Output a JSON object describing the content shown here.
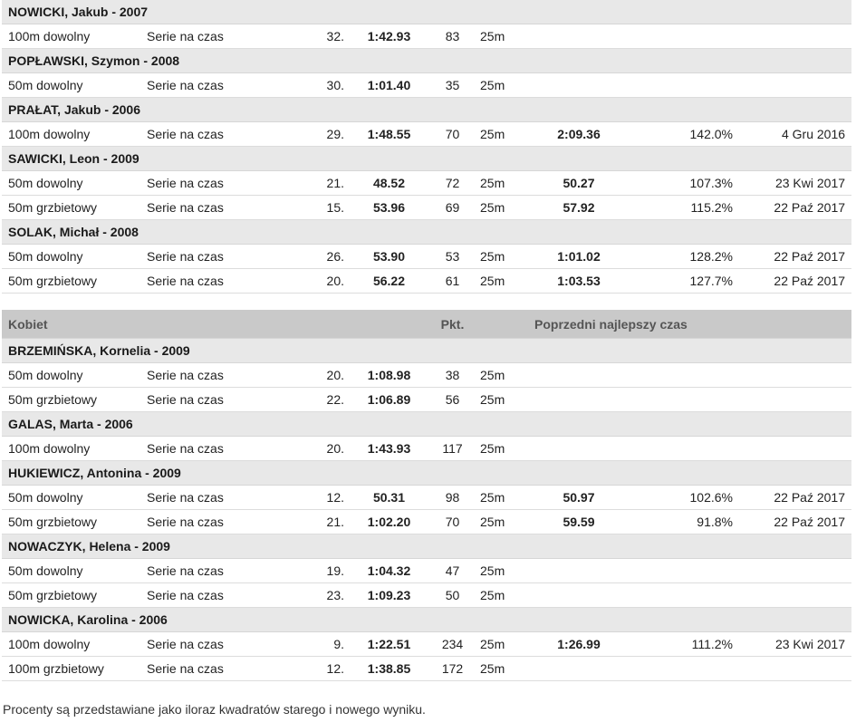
{
  "men_tail": [
    {
      "name": "NOWICKI, Jakub - 2007",
      "results": [
        {
          "event": "100m dowolny",
          "round": "Serie na czas",
          "place": "32.",
          "time": "1:42.93",
          "points": "83",
          "course": "25m",
          "prev_time": "",
          "percent": "",
          "date": ""
        }
      ]
    },
    {
      "name": "POPŁAWSKI, Szymon - 2008",
      "results": [
        {
          "event": "50m dowolny",
          "round": "Serie na czas",
          "place": "30.",
          "time": "1:01.40",
          "points": "35",
          "course": "25m",
          "prev_time": "",
          "percent": "",
          "date": ""
        }
      ]
    },
    {
      "name": "PRAŁAT, Jakub - 2006",
      "results": [
        {
          "event": "100m dowolny",
          "round": "Serie na czas",
          "place": "29.",
          "time": "1:48.55",
          "points": "70",
          "course": "25m",
          "prev_time": "2:09.36",
          "percent": "142.0%",
          "date": "4 Gru 2016"
        }
      ]
    },
    {
      "name": "SAWICKI, Leon - 2009",
      "results": [
        {
          "event": "50m dowolny",
          "round": "Serie na czas",
          "place": "21.",
          "time": "48.52",
          "points": "72",
          "course": "25m",
          "prev_time": "50.27",
          "percent": "107.3%",
          "date": "23 Kwi 2017"
        },
        {
          "event": "50m grzbietowy",
          "round": "Serie na czas",
          "place": "15.",
          "time": "53.96",
          "points": "69",
          "course": "25m",
          "prev_time": "57.92",
          "percent": "115.2%",
          "date": "22 Paź 2017"
        }
      ]
    },
    {
      "name": "SOLAK, Michał - 2008",
      "results": [
        {
          "event": "50m dowolny",
          "round": "Serie na czas",
          "place": "26.",
          "time": "53.90",
          "points": "53",
          "course": "25m",
          "prev_time": "1:01.02",
          "percent": "128.2%",
          "date": "22 Paź 2017"
        },
        {
          "event": "50m grzbietowy",
          "round": "Serie na czas",
          "place": "20.",
          "time": "56.22",
          "points": "61",
          "course": "25m",
          "prev_time": "1:03.53",
          "percent": "127.7%",
          "date": "22 Paź 2017"
        }
      ]
    }
  ],
  "women_header": {
    "category": "Kobiet",
    "points": "Pkt.",
    "previous_best": "Poprzedni najlepszy czas"
  },
  "women": [
    {
      "name": "BRZEMIŃSKA, Kornelia - 2009",
      "results": [
        {
          "event": "50m dowolny",
          "round": "Serie na czas",
          "place": "20.",
          "time": "1:08.98",
          "points": "38",
          "course": "25m",
          "prev_time": "",
          "percent": "",
          "date": ""
        },
        {
          "event": "50m grzbietowy",
          "round": "Serie na czas",
          "place": "22.",
          "time": "1:06.89",
          "points": "56",
          "course": "25m",
          "prev_time": "",
          "percent": "",
          "date": ""
        }
      ]
    },
    {
      "name": "GALAS, Marta - 2006",
      "results": [
        {
          "event": "100m dowolny",
          "round": "Serie na czas",
          "place": "20.",
          "time": "1:43.93",
          "points": "117",
          "course": "25m",
          "prev_time": "",
          "percent": "",
          "date": ""
        }
      ]
    },
    {
      "name": "HUKIEWICZ, Antonina - 2009",
      "results": [
        {
          "event": "50m dowolny",
          "round": "Serie na czas",
          "place": "12.",
          "time": "50.31",
          "points": "98",
          "course": "25m",
          "prev_time": "50.97",
          "percent": "102.6%",
          "date": "22 Paź 2017"
        },
        {
          "event": "50m grzbietowy",
          "round": "Serie na czas",
          "place": "21.",
          "time": "1:02.20",
          "points": "70",
          "course": "25m",
          "prev_time": "59.59",
          "percent": "91.8%",
          "date": "22 Paź 2017"
        }
      ]
    },
    {
      "name": "NOWACZYK, Helena - 2009",
      "results": [
        {
          "event": "50m dowolny",
          "round": "Serie na czas",
          "place": "19.",
          "time": "1:04.32",
          "points": "47",
          "course": "25m",
          "prev_time": "",
          "percent": "",
          "date": ""
        },
        {
          "event": "50m grzbietowy",
          "round": "Serie na czas",
          "place": "23.",
          "time": "1:09.23",
          "points": "50",
          "course": "25m",
          "prev_time": "",
          "percent": "",
          "date": ""
        }
      ]
    },
    {
      "name": "NOWICKA, Karolina - 2006",
      "results": [
        {
          "event": "100m dowolny",
          "round": "Serie na czas",
          "place": "9.",
          "time": "1:22.51",
          "points": "234",
          "course": "25m",
          "prev_time": "1:26.99",
          "percent": "111.2%",
          "date": "23 Kwi 2017"
        },
        {
          "event": "100m grzbietowy",
          "round": "Serie na czas",
          "place": "12.",
          "time": "1:38.85",
          "points": "172",
          "course": "25m",
          "prev_time": "",
          "percent": "",
          "date": ""
        }
      ]
    }
  ],
  "footnote": "Procenty są przedstawiane jako iloraz kwadratów starego i nowego wyniku."
}
